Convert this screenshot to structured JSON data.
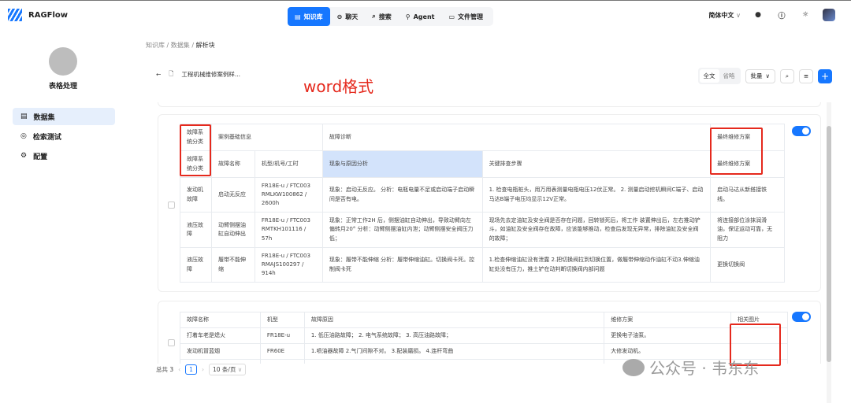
{
  "app": {
    "name": "RAGFlow"
  },
  "nav": [
    {
      "label": "知识库",
      "icon": "book-icon"
    },
    {
      "label": "聊天",
      "icon": "chat-icon"
    },
    {
      "label": "搜索",
      "icon": "search-icon"
    },
    {
      "label": "Agent",
      "icon": "agent-icon"
    },
    {
      "label": "文件管理",
      "icon": "folder-icon"
    }
  ],
  "header": {
    "language": "简体中文"
  },
  "sidebar": {
    "kb_name": "表格处理",
    "items": [
      {
        "label": "数据集"
      },
      {
        "label": "检索测试"
      },
      {
        "label": "配置"
      }
    ]
  },
  "breadcrumb": {
    "a": "知识库",
    "b": "数据集",
    "c": "解析块",
    "sep": "/"
  },
  "doc": {
    "title": "工程机械维修案例样..."
  },
  "annotation": "word格式",
  "toolbar": {
    "full": "全文",
    "omit": "省略",
    "batch": "批量"
  },
  "chunk1": {
    "head1": [
      "故障系统分类",
      "案例基础信息",
      "故障诊断",
      "最终维修方案"
    ],
    "head2": [
      "故障系统分类",
      "故障名称",
      "机型/机号/工时",
      "现象与原因分析",
      "关键排查步骤",
      "最终维修方案"
    ],
    "rows": [
      [
        "发动机故障",
        "启动无反应",
        "FR18E-u / FTC003 RMLKW100862 / 2600h",
        "现象：启动无反应。 分析：电瓶电量不足或启动端子启动瞬间是否有电。",
        "1. 检查电瓶桩头，用万用表测量电瓶电压12伏正常。 2. 测量启动挖机瞬间C端子、启动马达B端子电压均显示12V正常。",
        "启动马达从新搭接铁线。"
      ],
      [
        "液压故障",
        "动臂侧摆油缸自动伸出",
        "FR18E-u / FTC003 RMTKH101116 / 57h",
        "现象：正常工作2H 后，侧摆油缸自动伸出，导致动臂向左偏转月20° 分析：动臂侧摆油缸内泄；动臂侧摆安全阀压力低；",
        "现场先去定油缸及安全阀是否存在问题，回转锁死后，将工作 装置伸出后，左右推动铲斗，如油缸及安全阀存在故障，应该能够推动，检查后发现无异常，排除油缸及安全阀的故障；",
        "将连接部位涂抹润滑油，保证运动可靠，无阻力"
      ],
      [
        "液压故障",
        "履带不能伸缩",
        "FR18E-u / FTC003 RMAJS100297 / 914h",
        "现象：履带不能伸缩 分析：履带伸缩油缸。切换阀卡死。控制阀卡死",
        "1.检查伸缩油缸没有泄露 2.把切换阀拉到切换位置，做履带伸缩动作油缸不动3.伸缩油缸处没有压力，推土铲在动判断切换阀内部问题",
        "更换切换阀"
      ]
    ]
  },
  "chunk2": {
    "head": [
      "故障名称",
      "机型",
      "故障原因",
      "维修方案",
      "相关图片"
    ],
    "rows": [
      [
        "打着车老是熄火",
        "FR18E-u",
        "1. 低压油路故障； 2. 电气系统故障； 3. 高压油路故障；",
        "更换电子油泵。",
        ""
      ],
      [
        "发动机冒蓝烟",
        "FR60E",
        "1.喷油器故障 2.气门间隙不对。 3.配装磨损。 4.连杆弯曲",
        "大修发动机。",
        ""
      ]
    ]
  },
  "pagination": {
    "total": "总共 3",
    "page": "1",
    "size": "10 条/页"
  },
  "watermark": "公众号 · 韦东东"
}
